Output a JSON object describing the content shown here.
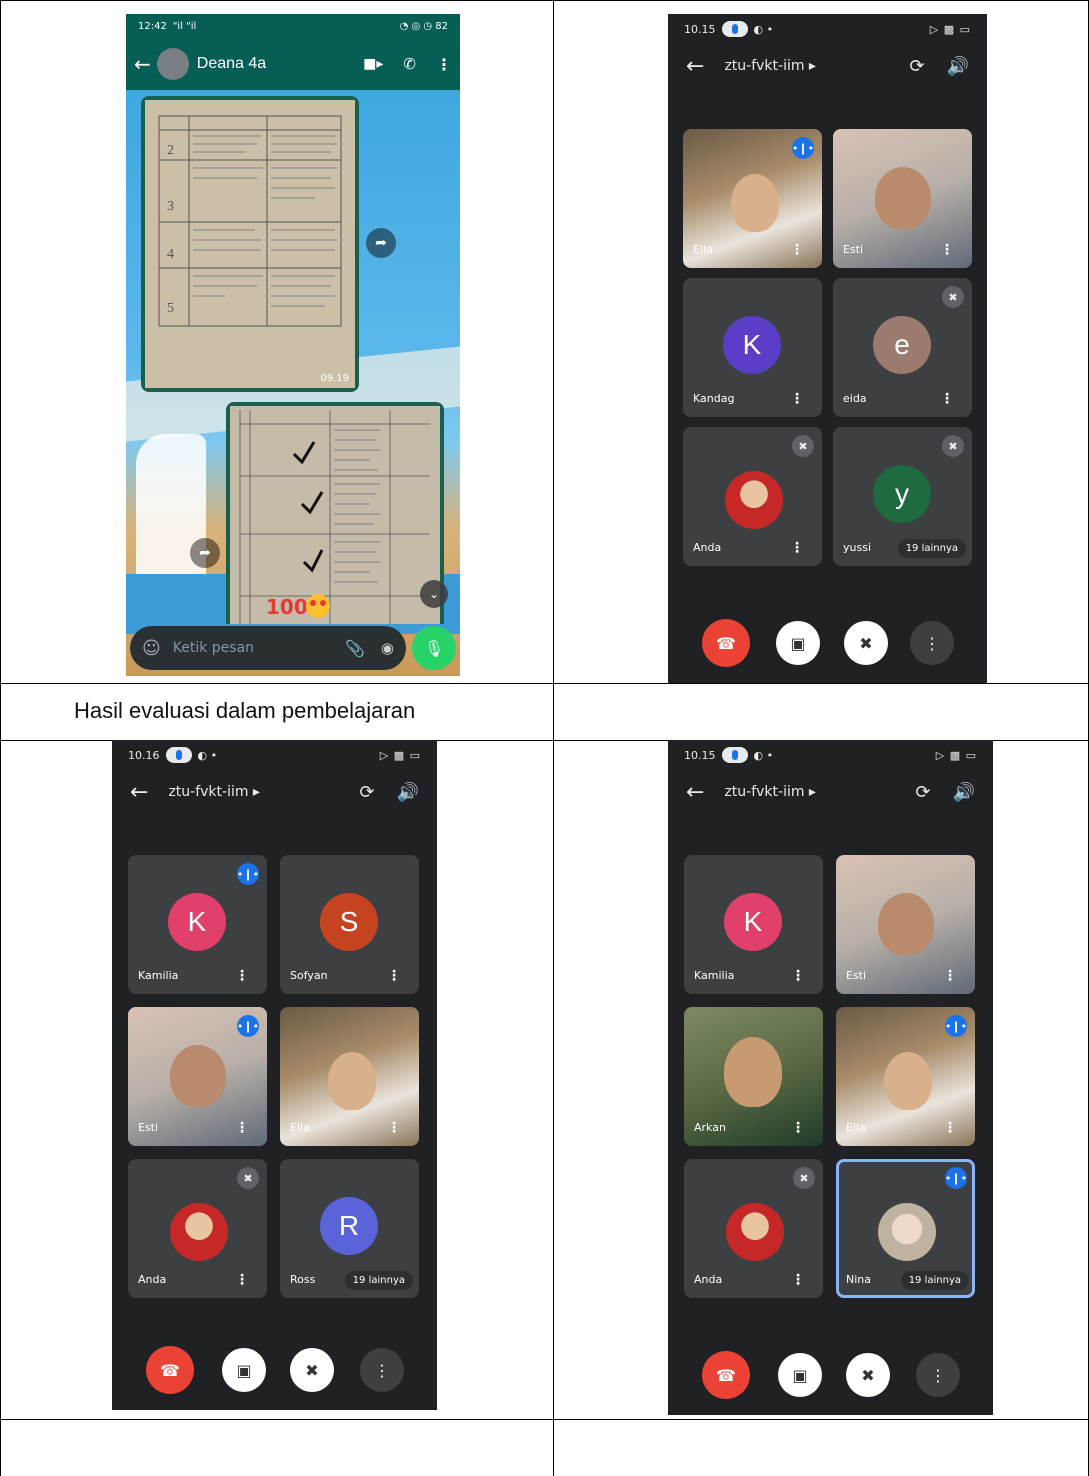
{
  "chat": {
    "status_time": "12:42",
    "status_signal": "\"il \"il",
    "status_icons": "◔ ◎ ◷ 82",
    "contact_name": "Deana 4a",
    "photo_time": "09.19",
    "input_placeholder": "Ketik pesan"
  },
  "caption": "Hasil evaluasi dalam pembelajaran",
  "meet_top": {
    "time": "10.15",
    "room": "ztu-fvkt-iim",
    "tiles": [
      {
        "name": "Ella"
      },
      {
        "name": "Esti"
      },
      {
        "name": "Kandag",
        "initial": "K"
      },
      {
        "name": "eida",
        "initial": "e"
      },
      {
        "name": "Anda"
      },
      {
        "name": "yussi",
        "initial": "y",
        "more": "19 lainnya"
      }
    ]
  },
  "meet_bl": {
    "time": "10.16",
    "room": "ztu-fvkt-iim",
    "tiles": [
      {
        "name": "Kamilia",
        "initial": "K"
      },
      {
        "name": "Sofyan",
        "initial": "S"
      },
      {
        "name": "Esti"
      },
      {
        "name": "Ella"
      },
      {
        "name": "Anda"
      },
      {
        "name": "Ross",
        "initial": "R",
        "more": "19 lainnya"
      }
    ]
  },
  "meet_br": {
    "time": "10.15",
    "room": "ztu-fvkt-iim",
    "tiles": [
      {
        "name": "Kamilia",
        "initial": "K"
      },
      {
        "name": "Esti"
      },
      {
        "name": "Arkan"
      },
      {
        "name": "Ella"
      },
      {
        "name": "Anda"
      },
      {
        "name": "Nina",
        "more": "19 lainnya"
      }
    ]
  },
  "colors": {
    "meet_bg": "#202124",
    "tile_bg": "#3c4043",
    "end_call": "#ea4335",
    "whatsapp_green": "#25d366",
    "highlight": "#8ab4f8",
    "avatar_kandag": "#5b3ec8",
    "avatar_eida": "#9c7b6e",
    "avatar_yussi": "#1e6b3f",
    "avatar_kamilia": "#e0406a",
    "avatar_sofyan": "#c5441f",
    "avatar_ross": "#5b63d8"
  }
}
